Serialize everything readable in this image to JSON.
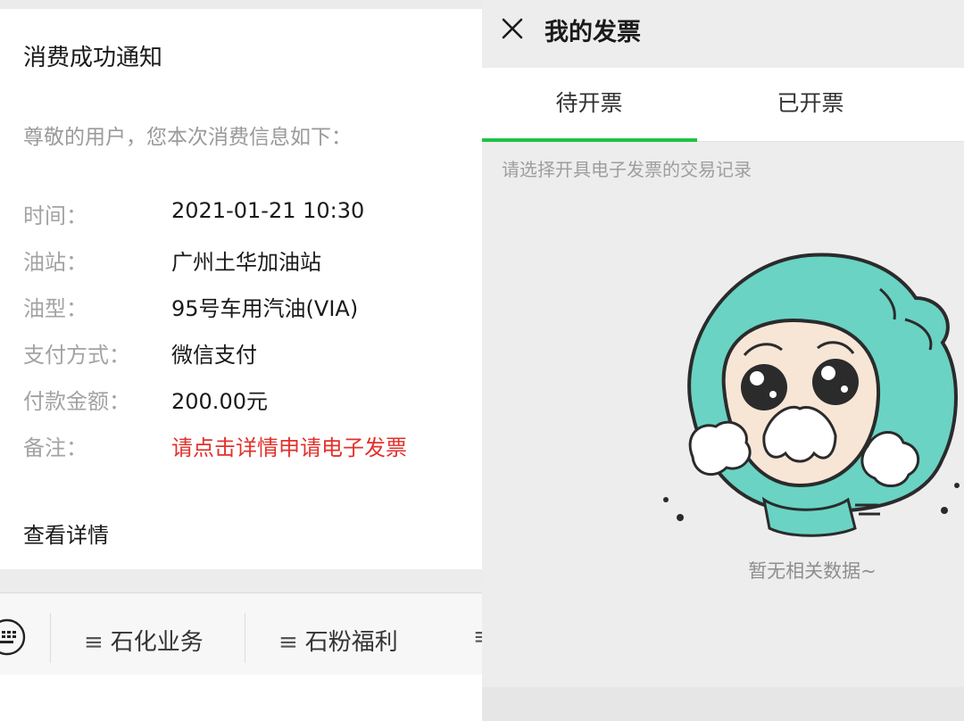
{
  "notice": {
    "title": "消费成功通知",
    "greeting": "尊敬的用户，您本次消费信息如下：",
    "fields": [
      {
        "label": "时间：",
        "value": "2021-01-21 10:30"
      },
      {
        "label": "油站：",
        "value": "广州土华加油站"
      },
      {
        "label": "油型：",
        "value": "95号车用汽油(VIA)"
      },
      {
        "label": "支付方式：",
        "value": "微信支付"
      },
      {
        "label": "付款金额：",
        "value": "200.00元"
      },
      {
        "label": "备注：",
        "value": "请点击详情申请电子发票"
      }
    ],
    "details_link": "查看详情"
  },
  "menu": {
    "items": [
      "石化业务",
      "石粉福利"
    ],
    "hamburger": "≡"
  },
  "invoice": {
    "title": "我的发票",
    "tabs": [
      "待开票",
      "已开票"
    ],
    "active_tab": "待开票",
    "hint": "请选择开具电子发票的交易记录",
    "empty_text": "暂无相关数据~"
  },
  "colors": {
    "accent_green": "#21c245",
    "remark_red": "#e3302b",
    "mascot_teal": "#6ad3c4"
  },
  "icons": [
    "close-icon",
    "keyboard-icon",
    "crying-mascot-icon"
  ]
}
